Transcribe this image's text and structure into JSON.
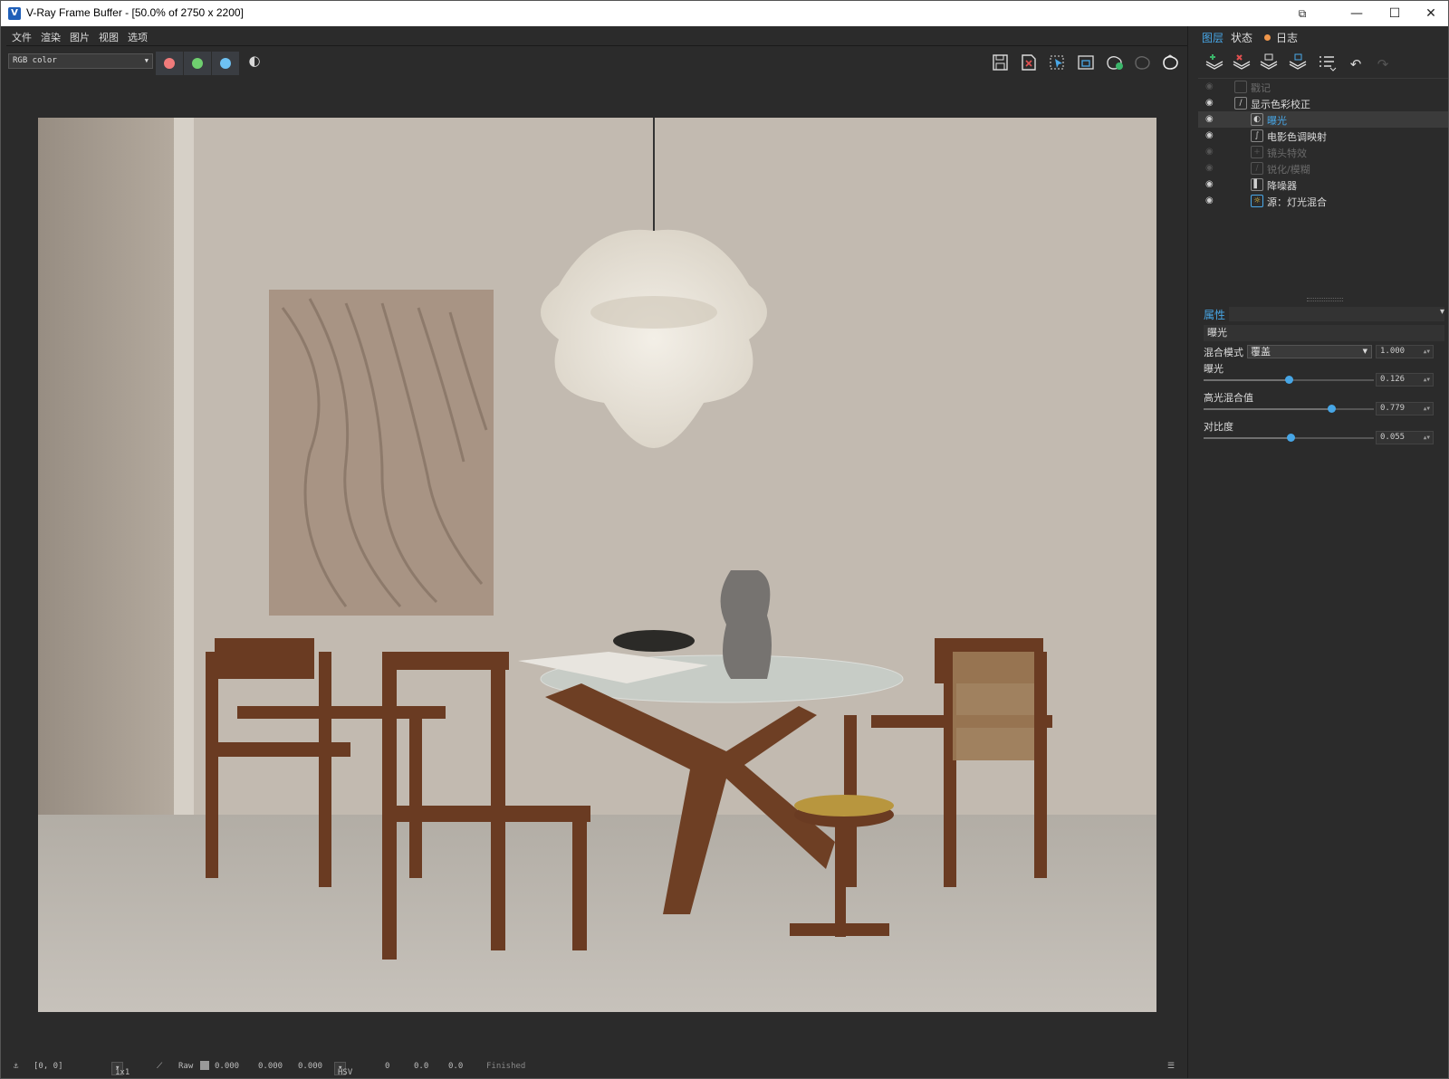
{
  "window": {
    "title": "V-Ray Frame Buffer - [50.0% of 2750 x 2200]",
    "controls": {
      "restore_icon": "⧉",
      "minimize": "—",
      "maximize": "☐",
      "close": "✕"
    }
  },
  "menu": [
    "文件",
    "渲染",
    "图片",
    "视图",
    "选项"
  ],
  "toolbar": {
    "channel": "RGB color",
    "channel_buttons": [
      {
        "name": "red-channel",
        "color": "#f07b7b"
      },
      {
        "name": "green-channel",
        "color": "#6fcf6f"
      },
      {
        "name": "blue-channel",
        "color": "#6ec1f2"
      }
    ],
    "icons": [
      "save-icon",
      "clear-image-icon",
      "region-render-icon",
      "render-region-frame-icon",
      "interactive-render-icon",
      "stop-render-icon",
      "render-teapot-icon"
    ]
  },
  "status": {
    "coords": "[0, 0]",
    "zoom": "1x1",
    "mode": "Raw",
    "rgb": [
      "0.000",
      "0.000",
      "0.000"
    ],
    "space": "HSV",
    "hsv": [
      "0",
      "0.0",
      "0.0"
    ],
    "state": "Finished"
  },
  "right_panel": {
    "tabs": [
      "图层",
      "状态",
      "日志"
    ],
    "layers": [
      {
        "name": "戳记",
        "indent": 0,
        "disabled": true,
        "icon": "stamp-icon"
      },
      {
        "name": "显示色彩校正",
        "indent": 0,
        "disabled": false,
        "icon": "display-correction-icon"
      },
      {
        "name": "曝光",
        "indent": 1,
        "disabled": false,
        "selected": true,
        "icon": "exposure-icon"
      },
      {
        "name": "电影色调映射",
        "indent": 1,
        "disabled": false,
        "icon": "filmic-tonemap-icon"
      },
      {
        "name": "镜头特效",
        "indent": 1,
        "disabled": true,
        "icon": "lens-effects-icon"
      },
      {
        "name": "锐化/模糊",
        "indent": 1,
        "disabled": true,
        "icon": "sharpen-blur-icon"
      },
      {
        "name": "降噪器",
        "indent": 1,
        "disabled": false,
        "icon": "denoiser-icon"
      },
      {
        "name": "源：灯光混合",
        "indent": 1,
        "disabled": false,
        "icon": "light-mix-source-icon"
      }
    ],
    "properties": {
      "title": "属性",
      "layer_name": "曝光",
      "blend_label": "混合模式",
      "blend_mode": "覆盖",
      "blend_value": "1.000",
      "params": [
        {
          "label": "曝光",
          "value": "0.126",
          "position": 0.5
        },
        {
          "label": "高光混合值",
          "value": "0.779",
          "position": 0.75
        },
        {
          "label": "对比度",
          "value": "0.055",
          "position": 0.51
        }
      ]
    }
  }
}
